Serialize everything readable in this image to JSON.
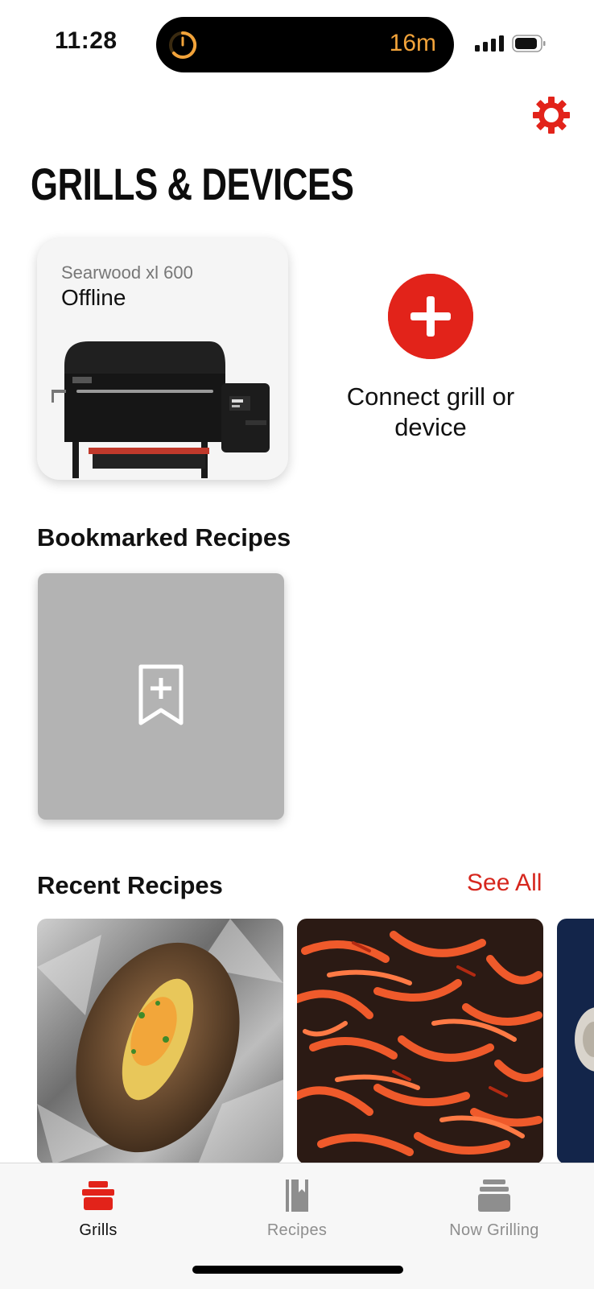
{
  "status_bar": {
    "time": "11:28",
    "timer": "16m"
  },
  "header": {
    "settings_icon": "gear-icon",
    "title": "GRILLS & DEVICES"
  },
  "grill": {
    "model": "Searwood xl 600",
    "status": "Offline"
  },
  "connect": {
    "icon": "plus-icon",
    "label": "Connect grill or device"
  },
  "bookmarked": {
    "title": "Bookmarked Recipes",
    "icon": "bookmark-add-icon"
  },
  "recent": {
    "title": "Recent Recipes",
    "see_all": "See All",
    "items": [
      {
        "image": "baked-potato-photo"
      },
      {
        "image": "grilled-peppers-photo"
      },
      {
        "image": "partial-recipe-photo"
      }
    ]
  },
  "tabbar": {
    "tabs": [
      {
        "label": "Grills",
        "icon": "grill-icon",
        "active": true
      },
      {
        "label": "Recipes",
        "icon": "recipe-book-icon",
        "active": false
      },
      {
        "label": "Now Grilling",
        "icon": "stack-icon",
        "active": false
      }
    ]
  },
  "colors": {
    "accent": "#e2231a",
    "see_all": "#d6261d",
    "timer": "#f2a33a"
  }
}
